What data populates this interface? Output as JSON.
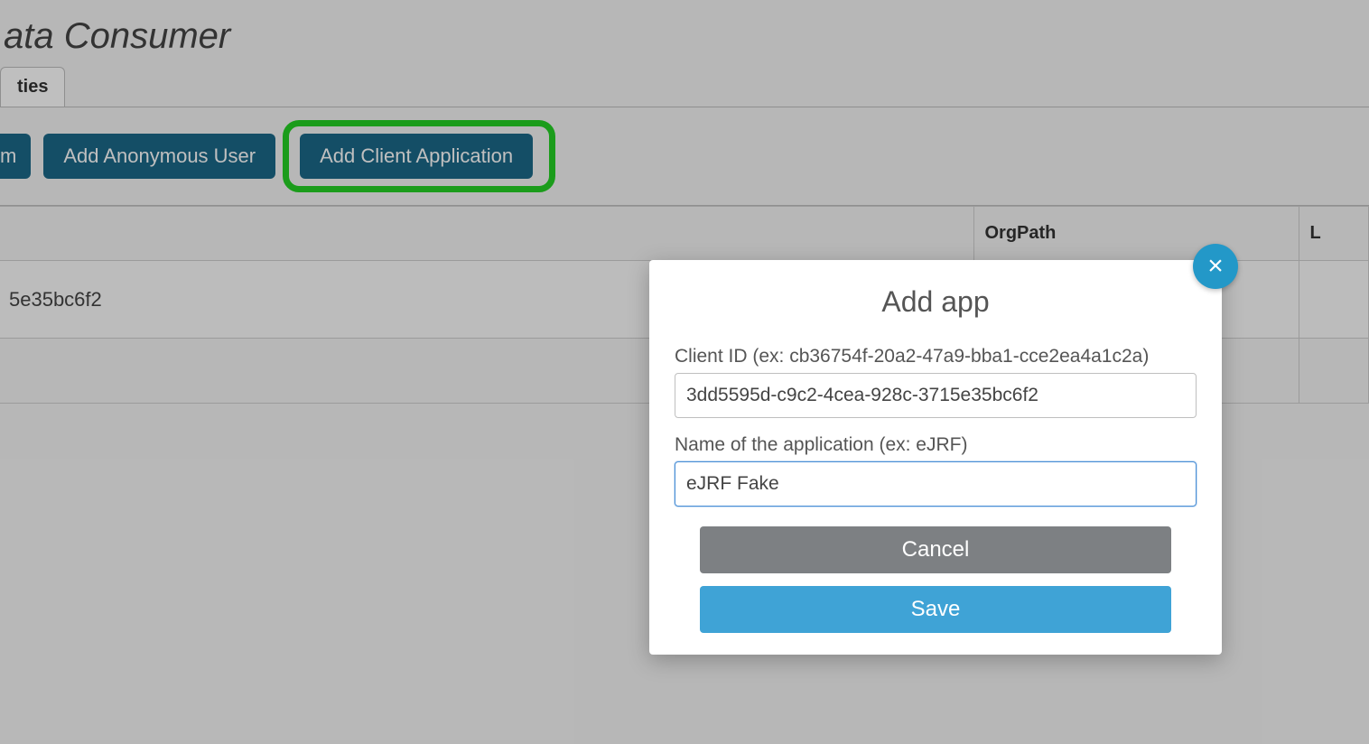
{
  "page": {
    "title_fragment": "ata Consumer",
    "tab_fragment": "ties"
  },
  "toolbar": {
    "btn_fragment": "m",
    "add_anonymous_user": "Add Anonymous User",
    "add_client_application": "Add Client Application"
  },
  "table": {
    "headers": {
      "first_fragment": "",
      "orgpath": "OrgPath",
      "last_fragment": "L"
    },
    "rows": [
      {
        "id_fragment": "5e35bc6f2"
      }
    ]
  },
  "modal": {
    "title": "Add app",
    "client_id_label": "Client ID (ex: cb36754f-20a2-47a9-bba1-cce2ea4a1c2a)",
    "client_id_value": "3dd5595d-c9c2-4cea-928c-3715e35bc6f2",
    "app_name_label": "Name of the application (ex: eJRF)",
    "app_name_value": "eJRF Fake",
    "cancel": "Cancel",
    "save": "Save",
    "close_glyph": "×"
  }
}
